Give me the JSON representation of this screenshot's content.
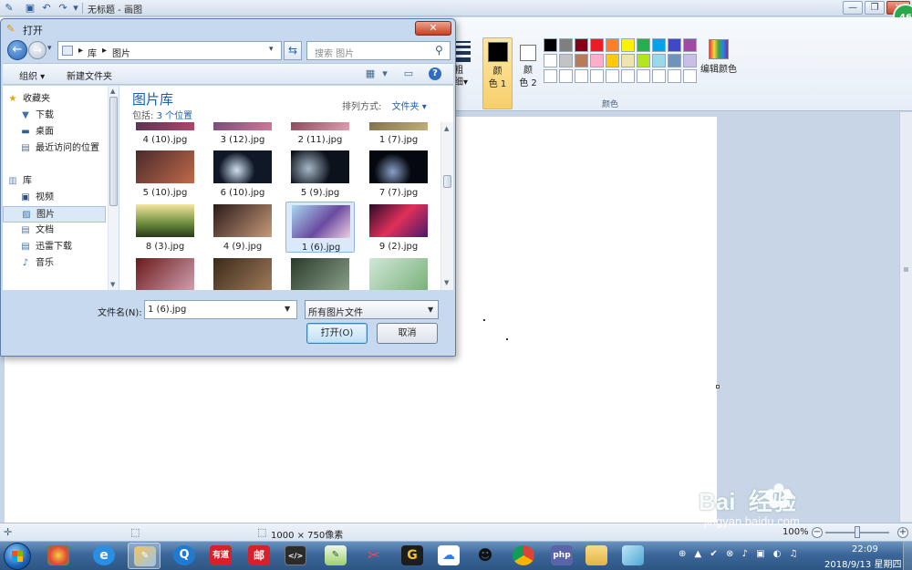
{
  "paint": {
    "title": "无标题 - 画图",
    "window_controls": {
      "minimize": "—",
      "restore": "❐",
      "close": "✕"
    },
    "badge": "46",
    "ribbon": {
      "stroke_label": "粗\n细▾",
      "color1_label": "颜\n色 1",
      "color2_label": "颜\n色 2",
      "edit_colors_label": "编辑颜色",
      "group_colors": "颜色",
      "palette_row1": [
        "#000000",
        "#7f7f7f",
        "#880015",
        "#ed1c24",
        "#ff7f27",
        "#fff200",
        "#22b14c",
        "#00a2e8",
        "#3f48cc",
        "#a349a4"
      ],
      "palette_row2": [
        "#ffffff",
        "#c3c3c3",
        "#b97a57",
        "#ffaec9",
        "#ffc90e",
        "#efe4b0",
        "#b5e61d",
        "#99d9ea",
        "#7092be",
        "#c8bfe7"
      ],
      "palette_row3": [
        "#ffffff",
        "#ffffff",
        "#ffffff",
        "#ffffff",
        "#ffffff",
        "#ffffff",
        "#ffffff",
        "#ffffff",
        "#ffffff",
        "#ffffff"
      ]
    },
    "status": {
      "canvas_size": "1000 × 750像素",
      "zoom": "100%"
    }
  },
  "dialog": {
    "title": "打开",
    "breadcrumb": [
      "库",
      "图片"
    ],
    "search_placeholder": "搜索 图片",
    "toolbar": {
      "organize": "组织 ▾",
      "new_folder": "新建文件夹"
    },
    "nav": {
      "favorites": "收藏夹",
      "downloads": "下载",
      "desktop": "桌面",
      "recent": "最近访问的位置",
      "libraries": "库",
      "videos": "视频",
      "pictures": "图片",
      "documents": "文档",
      "xunlei": "迅雷下载",
      "music": "音乐"
    },
    "library_title": "图片库",
    "library_includes_prefix": "包括:",
    "library_includes_link": "3 个位置",
    "sort_label": "排列方式:",
    "sort_value": "文件夹 ▾",
    "files": [
      "4 (10).jpg",
      "3 (12).jpg",
      "2 (11).jpg",
      "1 (7).jpg",
      "5 (10).jpg",
      "6 (10).jpg",
      "5 (9).jpg",
      "7 (7).jpg",
      "8 (3).jpg",
      "4 (9).jpg",
      "1 (6).jpg",
      "9 (2).jpg"
    ],
    "filename_label": "文件名(N):",
    "filename_value": "1 (6).jpg",
    "filetype_value": "所有图片文件",
    "open_button": "打开(O)",
    "cancel_button": "取消"
  },
  "taskbar": {
    "apps": [
      "有道",
      "邮",
      "php"
    ],
    "tray": "⊕ ▲ ✔ ⊗ ♪ ▣ ◐ ♫",
    "time": "22:09",
    "date": "2018/9/13 星期四"
  },
  "watermark": {
    "brand": "Bai  经验",
    "url": "jingyan.baidu.com"
  }
}
